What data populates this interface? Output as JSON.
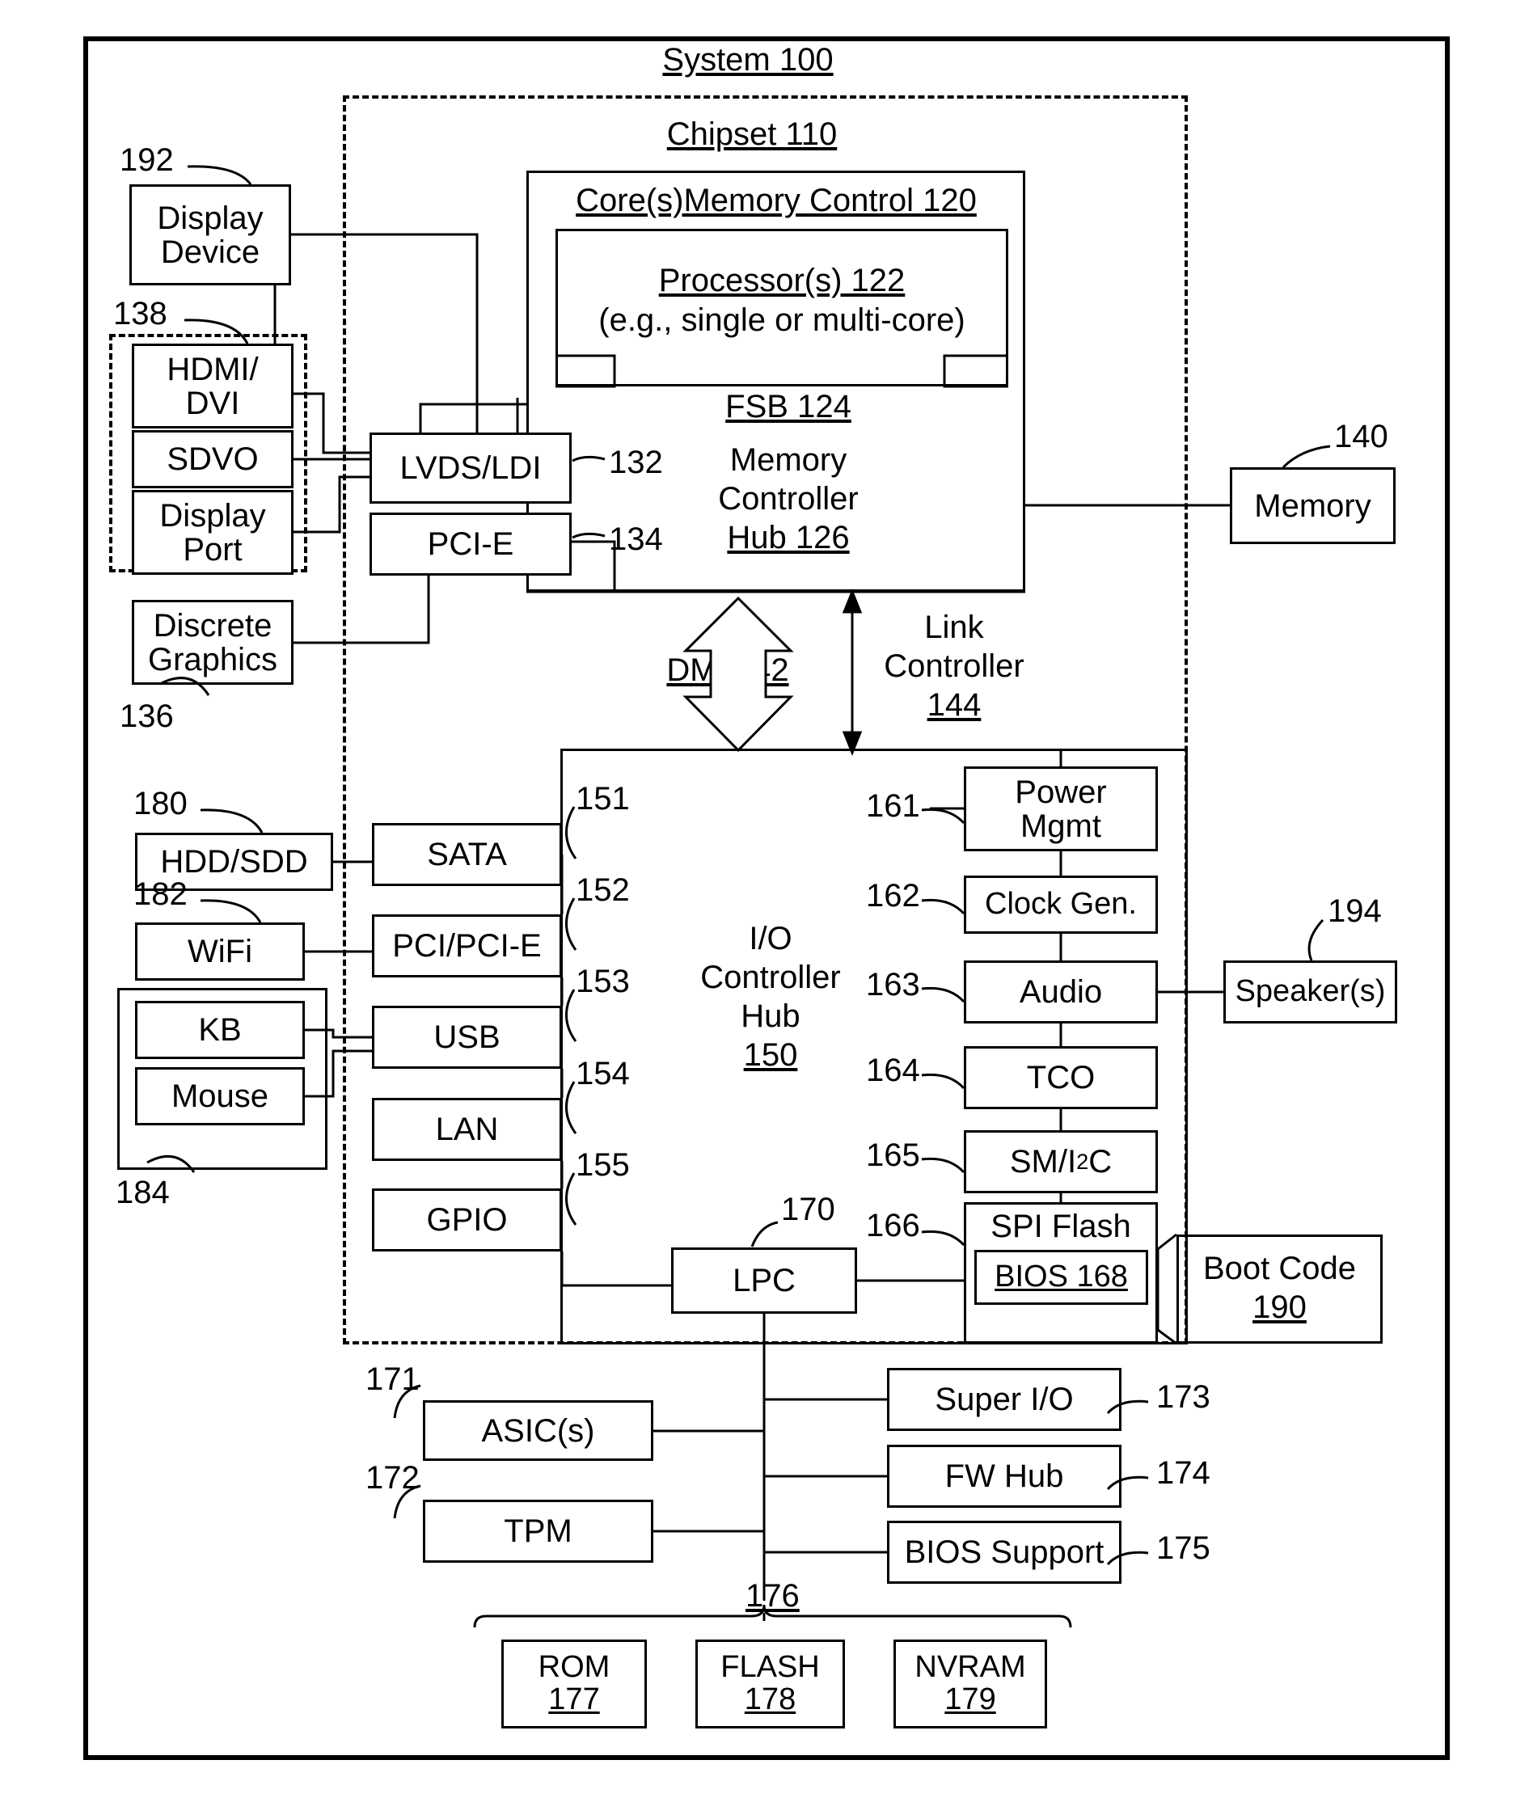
{
  "figure": {
    "system_title": "System 100",
    "chipset_title": "Chipset 110",
    "core_memory_title": "Core(s)Memory Control 120",
    "processor_line1": "Processor(s) 122",
    "processor_line2": "(e.g., single or multi-core)",
    "fsb_label": "FSB 124",
    "mch_line1": "Memory",
    "mch_line2": "Controller",
    "mch_line3": "Hub 126",
    "dmi_label": "DMI 142",
    "link_line1": "Link",
    "link_line2": "Controller",
    "link_line3": "144",
    "ioch_line1": "I/O",
    "ioch_line2": "Controller",
    "ioch_line3": "Hub",
    "ioch_line4": "150"
  },
  "blocks": {
    "display_device": "Display\nDevice",
    "hdmi_dvi": "HDMI/\nDVI",
    "sdvo": "SDVO",
    "display_port": "Display\nPort",
    "discrete_graphics": "Discrete\nGraphics",
    "lvds_ldi": "LVDS/LDI",
    "pci_e": "PCI-E",
    "memory": "Memory",
    "hdd_sdd": "HDD/SDD",
    "wifi": "WiFi",
    "kb": "KB",
    "mouse": "Mouse",
    "sata": "SATA",
    "pci_pcie": "PCI/PCI-E",
    "usb": "USB",
    "lan": "LAN",
    "gpio": "GPIO",
    "power_mgmt": "Power\nMgmt",
    "clock_gen": "Clock Gen.",
    "audio": "Audio",
    "tco": "TCO",
    "sm_i2c_pre": "SM/I",
    "sm_i2c_sup": "2",
    "sm_i2c_post": "C",
    "spi_flash": "SPI Flash",
    "bios": "BIOS 168",
    "boot_code_l1": "Boot Code",
    "boot_code_l2": "190",
    "speakers": "Speaker(s)",
    "lpc": "LPC",
    "asic": "ASIC(s)",
    "tpm": "TPM",
    "super_io": "Super I/O",
    "fw_hub": "FW Hub",
    "bios_support": "BIOS Support",
    "rom_l1": "ROM",
    "rom_l2": "177",
    "flash_l1": "FLASH",
    "flash_l2": "178",
    "nvram_l1": "NVRAM",
    "nvram_l2": "179"
  },
  "refs": {
    "r192": "192",
    "r138": "138",
    "r136": "136",
    "r132": "132",
    "r134": "134",
    "r140": "140",
    "r180": "180",
    "r182": "182",
    "r184": "184",
    "r151": "151",
    "r152": "152",
    "r153": "153",
    "r154": "154",
    "r155": "155",
    "r161": "161",
    "r162": "162",
    "r163": "163",
    "r164": "164",
    "r165": "165",
    "r166": "166",
    "r170": "170",
    "r171": "171",
    "r172": "172",
    "r173": "173",
    "r174": "174",
    "r175": "175",
    "r176": "176",
    "r194": "194"
  },
  "colors": {
    "line": "#000000",
    "background": "#ffffff"
  }
}
